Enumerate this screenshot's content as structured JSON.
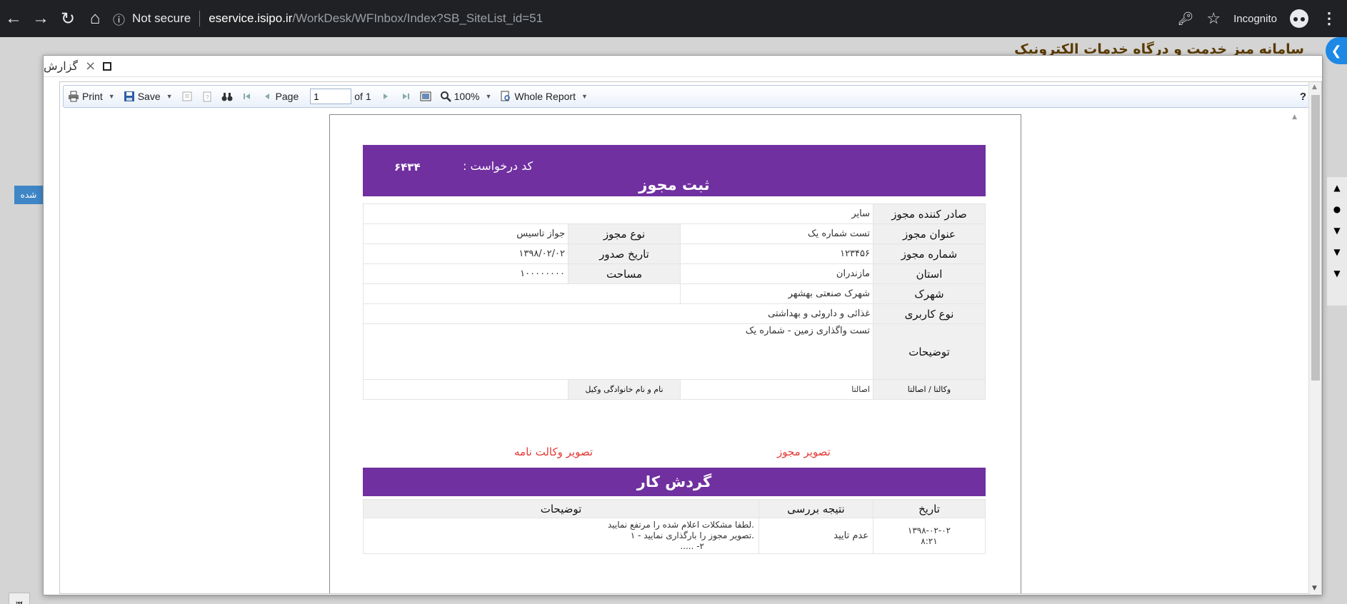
{
  "browser": {
    "security_label": "Not secure",
    "url_host": "eservice.isipo.ir",
    "url_path": "/WorkDesk/WFInbox/Index?SB_SiteList_id=51",
    "incognito_label": "Incognito"
  },
  "background": {
    "page_title": "سامانه میز خدمت و درگاه خدمات الکترونیک",
    "badge_label": "شده"
  },
  "modal": {
    "title": "گزارش"
  },
  "toolbar": {
    "print_label": "Print",
    "save_label": "Save",
    "page_label": "Page",
    "page_value": "1",
    "of_label": "of 1",
    "zoom_label": "100%",
    "view_label": "Whole Report",
    "help_label": "?"
  },
  "report": {
    "code_label": "کد درخواست :",
    "code_value": "۶۴۳۴",
    "title": "ثبت مجوز",
    "rows": {
      "issuer_label": "صادر کننده مجوز",
      "issuer_value": "سایر",
      "license_title_label": "عنوان مجوز",
      "license_title_value": "تست شماره یک",
      "license_type_label": "نوع مجوز",
      "license_type_value": "جواز تاسیس",
      "license_number_label": "شماره مجوز",
      "license_number_value": "۱۲۳۴۵۶",
      "issue_date_label": "تاریخ صدور",
      "issue_date_value": "۱۳۹۸/۰۲/۰۲",
      "province_label": "استان",
      "province_value": "مازندران",
      "area_label": "مساحت",
      "area_value": "۱۰۰۰۰۰۰۰۰",
      "town_label": "شهرک",
      "town_value": "شهرک صنعتی بهشهر",
      "usage_label": "نوع کاربری",
      "usage_value": "غذائی و داروئی و بهداشتی",
      "description_label": "توضیحات",
      "description_value": "تست واگذاری زمین - شماره یک",
      "agency_label": "وکالتا / اصالتا",
      "agency_value": "اصالتا",
      "attorney_label": "نام و نام خانوادگی وکیل",
      "attorney_value": ""
    },
    "license_image_link": "تصویر مجوز",
    "attorney_image_link": "تصویر وکالت نامه",
    "workflow_title": "گردش کار",
    "workflow_headers": {
      "date": "تاریخ",
      "result": "نتیجه بررسی",
      "description": "توضیحات"
    },
    "workflow_row": {
      "date_line1": "۱۳۹۸-۰۲-۰۲",
      "date_line2": "۸:۲۱",
      "result": "عدم تایید",
      "desc_line1": ".لطفا مشکلات اعلام شده را مرتفع نمایید",
      "desc_line2": ".تصویر مجوز را بارگذاری نمایید - ۱",
      "desc_line3": "۲- ....."
    }
  },
  "colors": {
    "band": "#7030a0",
    "link": "#e53935",
    "chrome": "#202124"
  }
}
